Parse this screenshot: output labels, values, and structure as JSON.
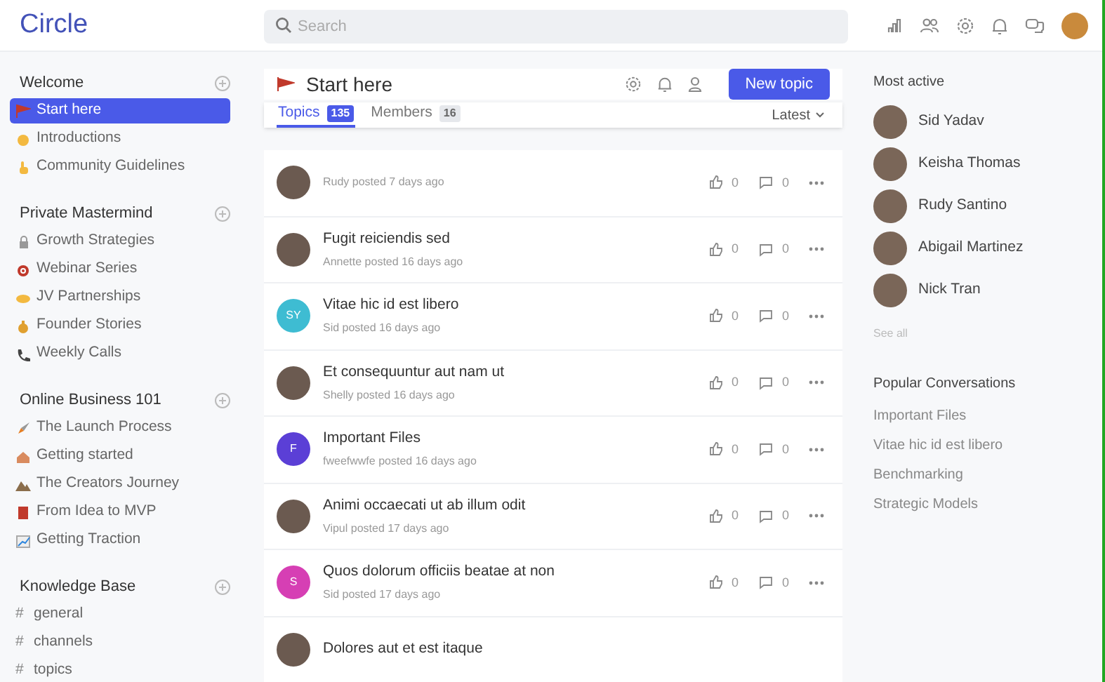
{
  "app": {
    "logo": "Circle",
    "search": {
      "placeholder": "Search"
    }
  },
  "sidebar": {
    "groups": [
      {
        "title": "Welcome",
        "items": [
          {
            "label": "Start here",
            "kind": "emoji",
            "selected": true
          },
          {
            "label": "Introductions",
            "kind": "emoji",
            "selected": false
          },
          {
            "label": "Community Guidelines",
            "kind": "emoji",
            "selected": false
          }
        ]
      },
      {
        "title": "Private Mastermind",
        "items": [
          {
            "label": "Growth Strategies",
            "kind": "emoji",
            "selected": false
          },
          {
            "label": "Webinar Series",
            "kind": "emoji",
            "selected": false
          },
          {
            "label": "JV Partnerships",
            "kind": "emoji",
            "selected": false
          },
          {
            "label": "Founder Stories",
            "kind": "emoji",
            "selected": false
          },
          {
            "label": "Weekly Calls",
            "kind": "emoji",
            "selected": false
          }
        ]
      },
      {
        "title": "Online Business 101",
        "items": [
          {
            "label": "The Launch Process",
            "kind": "emoji",
            "selected": false
          },
          {
            "label": "Getting started",
            "kind": "emoji",
            "selected": false
          },
          {
            "label": "The Creators Journey",
            "kind": "emoji",
            "selected": false
          },
          {
            "label": "From Idea to MVP",
            "kind": "emoji",
            "selected": false
          },
          {
            "label": "Getting Traction",
            "kind": "emoji",
            "selected": false
          }
        ]
      },
      {
        "title": "Knowledge Base",
        "items": [
          {
            "label": "general",
            "kind": "channel",
            "prefix": "#",
            "selected": false
          },
          {
            "label": "channels",
            "kind": "channel",
            "prefix": "#",
            "selected": false
          },
          {
            "label": "topics",
            "kind": "channel",
            "prefix": "#",
            "selected": false
          }
        ]
      }
    ]
  },
  "space": {
    "title": "Start here",
    "button": "New topic",
    "tabs": [
      {
        "label": "Topics",
        "count": "135",
        "selected": true
      },
      {
        "label": "Members",
        "count": "16",
        "selected": false
      }
    ],
    "sort": "Latest",
    "topics": [
      {
        "meta": "Rudy posted 7 days ago",
        "avatar": {
          "kind": "photo"
        },
        "likes": "0",
        "comments": "0"
      },
      {
        "title": "Fugit reiciendis sed",
        "meta": "Annette posted 16 days ago",
        "avatar": {
          "kind": "photo"
        },
        "likes": "0",
        "comments": "0"
      },
      {
        "title": "Vitae hic id est libero",
        "meta": "Sid posted 16 days ago",
        "avatar": {
          "kind": "initials",
          "initials": "SY",
          "color": "#3ebcd2"
        },
        "likes": "0",
        "comments": "0"
      },
      {
        "title": "Et consequuntur aut nam ut",
        "meta": "Shelly posted 16 days ago",
        "avatar": {
          "kind": "photo"
        },
        "likes": "0",
        "comments": "0"
      },
      {
        "title": "Important Files",
        "meta": "fweefwwfe posted 16 days ago",
        "avatar": {
          "kind": "initials",
          "initials": "F",
          "color": "#5b3fd6"
        },
        "likes": "0",
        "comments": "0"
      },
      {
        "title": "Animi occaecati ut ab illum odit",
        "meta": "Vipul posted 17 days ago",
        "avatar": {
          "kind": "photo"
        },
        "likes": "0",
        "comments": "0"
      },
      {
        "title": "Quos dolorum officiis beatae at non",
        "meta": "Sid posted 17 days ago",
        "avatar": {
          "kind": "initials",
          "initials": "S",
          "color": "#d63fb4"
        },
        "likes": "0",
        "comments": "0"
      },
      {
        "title": "Dolores aut et est itaque",
        "avatar": {
          "kind": "photo"
        }
      }
    ]
  },
  "aside": {
    "most_active": {
      "title": "Most active",
      "members": [
        "Sid Yadav",
        "Keisha Thomas",
        "Rudy Santino",
        "Abigail Martinez",
        "Nick Tran"
      ],
      "link": "See all"
    },
    "popular": {
      "title": "Popular Conversations",
      "items": [
        "Important Files",
        "Vitae hic id est libero",
        "Benchmarking",
        "Strategic Models"
      ]
    }
  }
}
